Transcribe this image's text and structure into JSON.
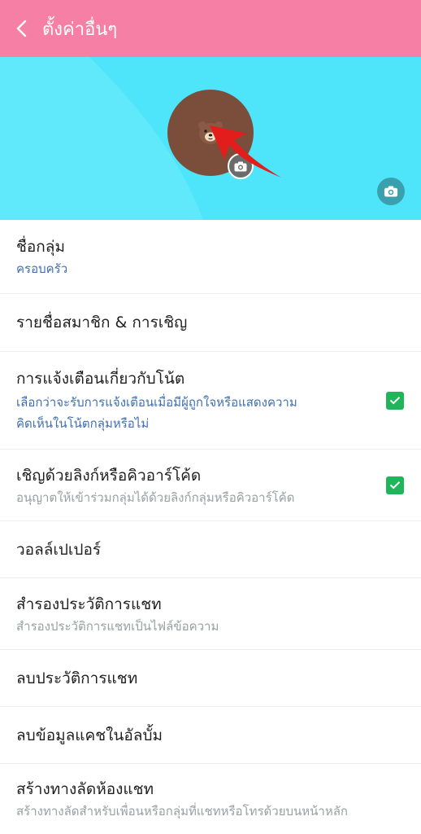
{
  "header": {
    "title": "ตั้งค่าอื่นๆ",
    "background_color": "#f67fa6",
    "back_icon": "chevron-left-icon"
  },
  "cover": {
    "background_color": "#4ee4f9",
    "avatar_icon": "bear-face-icon",
    "avatar_camera_icon": "camera-icon",
    "cover_camera_icon": "camera-icon",
    "annotation_arrow_color": "#e31c1c"
  },
  "settings": {
    "group_name": {
      "label": "ชื่อกลุ่ม",
      "value": "ครอบครัว"
    },
    "members": {
      "label": "รายชื่อสมาชิก & การเชิญ"
    },
    "note_notifications": {
      "label": "การแจ้งเตือนเกี่ยวกับโน้ต",
      "desc_line1": "เลือกว่าจะรับการแจ้งเตือนเมื่อมีผู้ถูกใจหรือแสดงความ",
      "desc_line2": "คิดเห็นในโน้ตกลุ่มหรือไม่",
      "checked": true
    },
    "invite_link": {
      "label": "เชิญด้วยลิงก์หรือคิวอาร์โค้ด",
      "desc": "อนุญาตให้เข้าร่วมกลุ่มได้ด้วยลิงก์กลุ่มหรือคิวอาร์โค้ด",
      "checked": true
    },
    "wallpaper": {
      "label": "วอลล์เปเปอร์"
    },
    "backup": {
      "label": "สำรองประวัติการแชท",
      "desc": "สำรองประวัติการแชทเป็นไฟล์ข้อความ"
    },
    "delete_history": {
      "label": "ลบประวัติการแชท"
    },
    "clear_cache": {
      "label": "ลบข้อมูลแคชในอัลบั้ม"
    },
    "shortcut": {
      "label": "สร้างทางลัดห้องแชท",
      "desc": "สร้างทางลัดสำหรับเพื่อนหรือกลุ่มที่แชทหรือโทรด้วยบนหน้าหลัก"
    }
  },
  "checkbox_color": "#1fb55a"
}
